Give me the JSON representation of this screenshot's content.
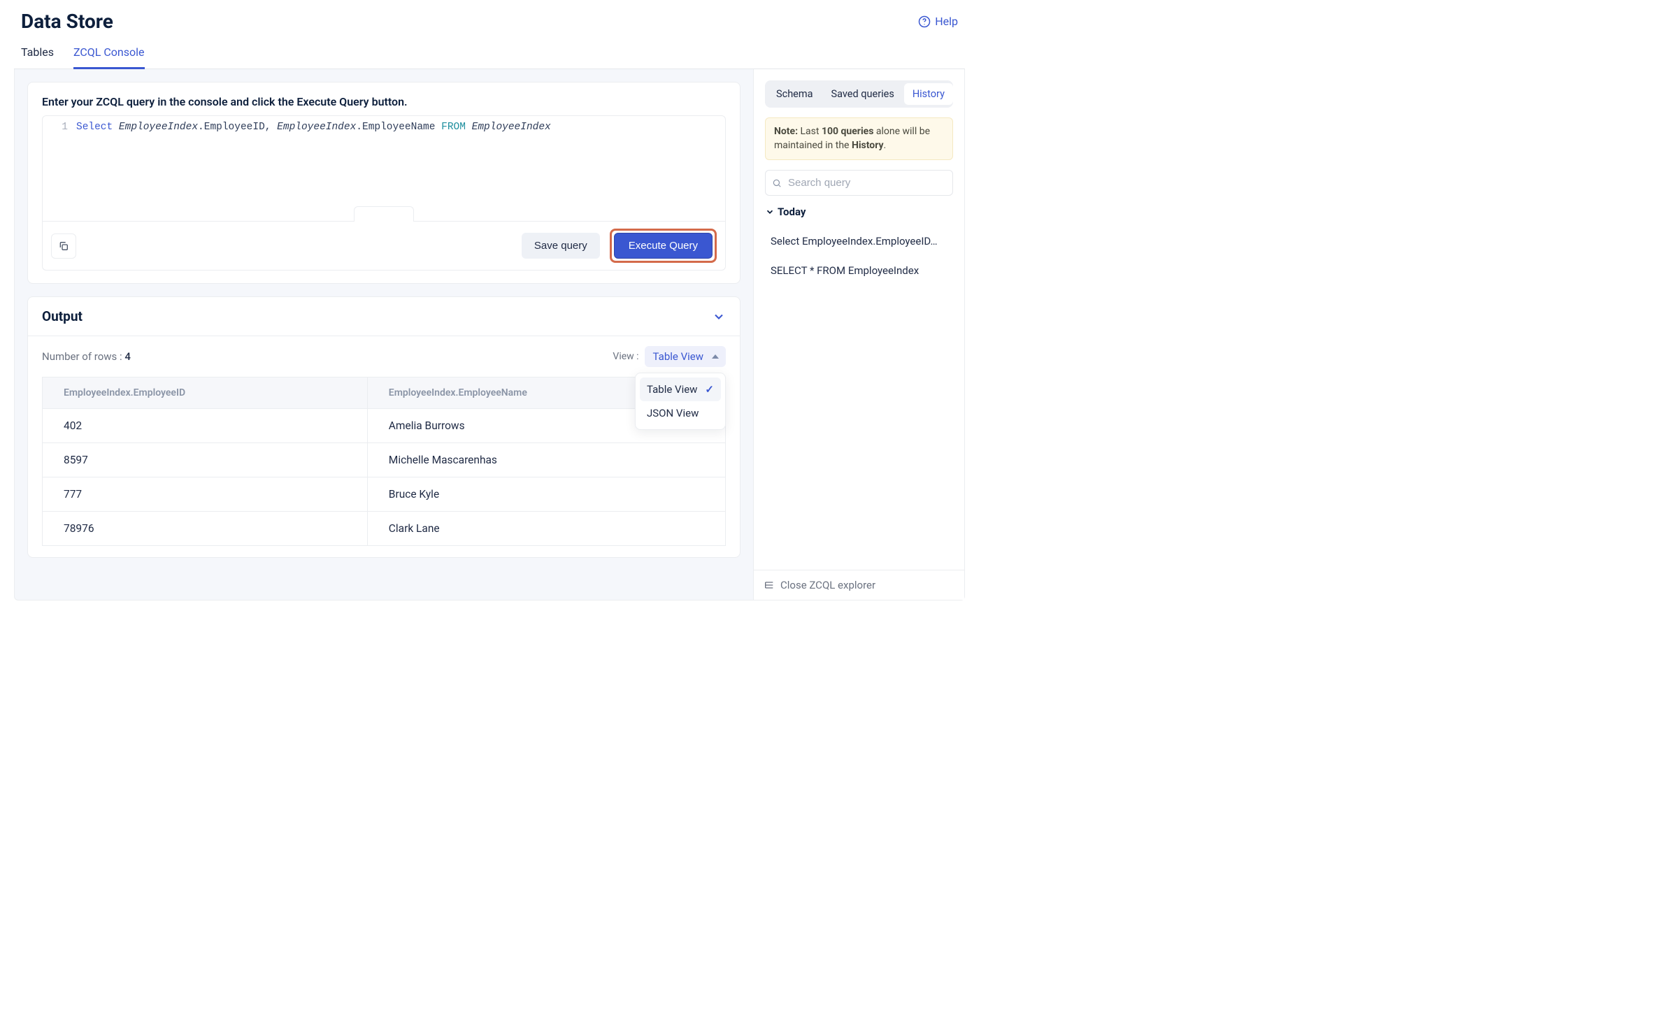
{
  "header": {
    "title": "Data Store",
    "help_label": "Help"
  },
  "tabs": [
    {
      "label": "Tables",
      "active": false
    },
    {
      "label": "ZCQL Console",
      "active": true
    }
  ],
  "editor": {
    "prompt": "Enter your ZCQL query in the console and click the Execute Query button.",
    "line_number": "1",
    "tokens": {
      "select": "Select",
      "tbl": "EmployeeIndex",
      "dot": ".",
      "col1": "EmployeeID",
      "comma": ", ",
      "col2": "EmployeeName",
      "from": "FROM",
      "tbl2": "EmployeeIndex"
    },
    "save_label": "Save query",
    "execute_label": "Execute Query"
  },
  "output": {
    "title": "Output",
    "rows_prefix": "Number of rows : ",
    "rows_value": "4",
    "view_label": "View :",
    "view_value": "Table View",
    "view_options": [
      {
        "label": "Table View",
        "selected": true
      },
      {
        "label": "JSON View",
        "selected": false
      }
    ],
    "columns": [
      "EmployeeIndex.EmployeeID",
      "EmployeeIndex.EmployeeName"
    ],
    "rows": [
      [
        "402",
        "Amelia Burrows"
      ],
      [
        "8597",
        "Michelle Mascarenhas"
      ],
      [
        "777",
        "Bruce Kyle"
      ],
      [
        "78976",
        "Clark Lane"
      ]
    ]
  },
  "sidebar": {
    "tabs": [
      {
        "label": "Schema",
        "active": false
      },
      {
        "label": "Saved queries",
        "active": false
      },
      {
        "label": "History",
        "active": true
      }
    ],
    "note_leading": "Note:",
    "note_mid1": " Last ",
    "note_bold": "100 queries",
    "note_mid2": " alone will be maintained in the ",
    "note_trail": "History",
    "note_end": ".",
    "search_placeholder": "Search query",
    "group_label": "Today",
    "history": [
      "Select EmployeeIndex.EmployeeID…",
      "SELECT * FROM EmployeeIndex"
    ],
    "footer_label": "Close ZCQL explorer"
  }
}
